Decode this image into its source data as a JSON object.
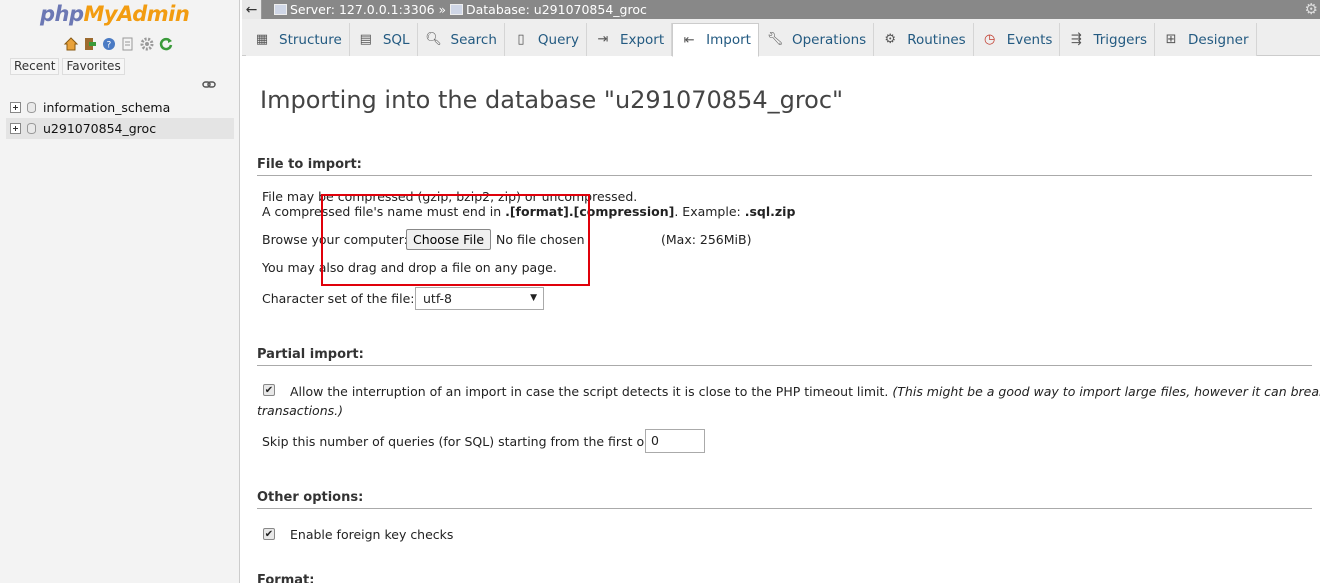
{
  "nav": {
    "logo_php": "php",
    "logo_myadmin": "MyAdmin",
    "icons": [
      "home-icon",
      "exit-icon",
      "help-icon",
      "docs-icon",
      "settings-icon",
      "reload-icon"
    ],
    "recent_label": "Recent",
    "favorites_label": "Favorites",
    "databases": [
      {
        "label": "information_schema",
        "selected": false
      },
      {
        "label": "u291070854_groc",
        "selected": true
      }
    ]
  },
  "breadcrumb": {
    "server": "Server: 127.0.0.1:3306",
    "separator": "»",
    "database": "Database: u291070854_groc"
  },
  "tabs": [
    {
      "label": "Structure",
      "icon": "structure-icon"
    },
    {
      "label": "SQL",
      "icon": "sql-icon"
    },
    {
      "label": "Search",
      "icon": "search-icon"
    },
    {
      "label": "Query",
      "icon": "query-icon"
    },
    {
      "label": "Export",
      "icon": "export-icon"
    },
    {
      "label": "Import",
      "icon": "import-icon",
      "active": true
    },
    {
      "label": "Operations",
      "icon": "wrench-icon"
    },
    {
      "label": "Routines",
      "icon": "routines-icon"
    },
    {
      "label": "Events",
      "icon": "clock-icon"
    },
    {
      "label": "Triggers",
      "icon": "triggers-icon"
    },
    {
      "label": "Designer",
      "icon": "designer-icon"
    }
  ],
  "main": {
    "title": "Importing into the database \"u291070854_groc\"",
    "file_section": {
      "heading": "File to import:",
      "line1": "File may be compressed (gzip, bzip2, zip) or uncompressed.",
      "line2_prefix": "A compressed file's name must end in ",
      "line2_bold": ".[format].[compression]",
      "line2_mid": ". Example: ",
      "line2_example": ".sql.zip",
      "browse_label": "Browse your computer:",
      "choose_button": "Choose File",
      "no_file": "No file chosen",
      "max_size": "(Max: 256MiB)",
      "drag_drop": "You may also drag and drop a file on any page.",
      "charset_label": "Character set of the file:",
      "charset_value": "utf-8"
    },
    "partial_section": {
      "heading": "Partial import:",
      "allow_interrupt_checked": true,
      "allow_interrupt_text": "Allow the interruption of an import in case the script detects it is close to the PHP timeout limit.",
      "allow_interrupt_note_a": "(This might be a good way to import large files, however it can break",
      "allow_interrupt_note_b": "transactions.)",
      "skip_label": "Skip this number of queries (for SQL) starting from the first one:",
      "skip_value": "0"
    },
    "other_section": {
      "heading": "Other options:",
      "fk_checked": true,
      "fk_label": "Enable foreign key checks"
    },
    "format_section": {
      "heading": "Format:"
    }
  },
  "colors": {
    "highlight_box": "#e0000a",
    "tab_text": "#235a81",
    "logo_php": "#6c78b4",
    "logo_myadmin": "#f29c11"
  }
}
